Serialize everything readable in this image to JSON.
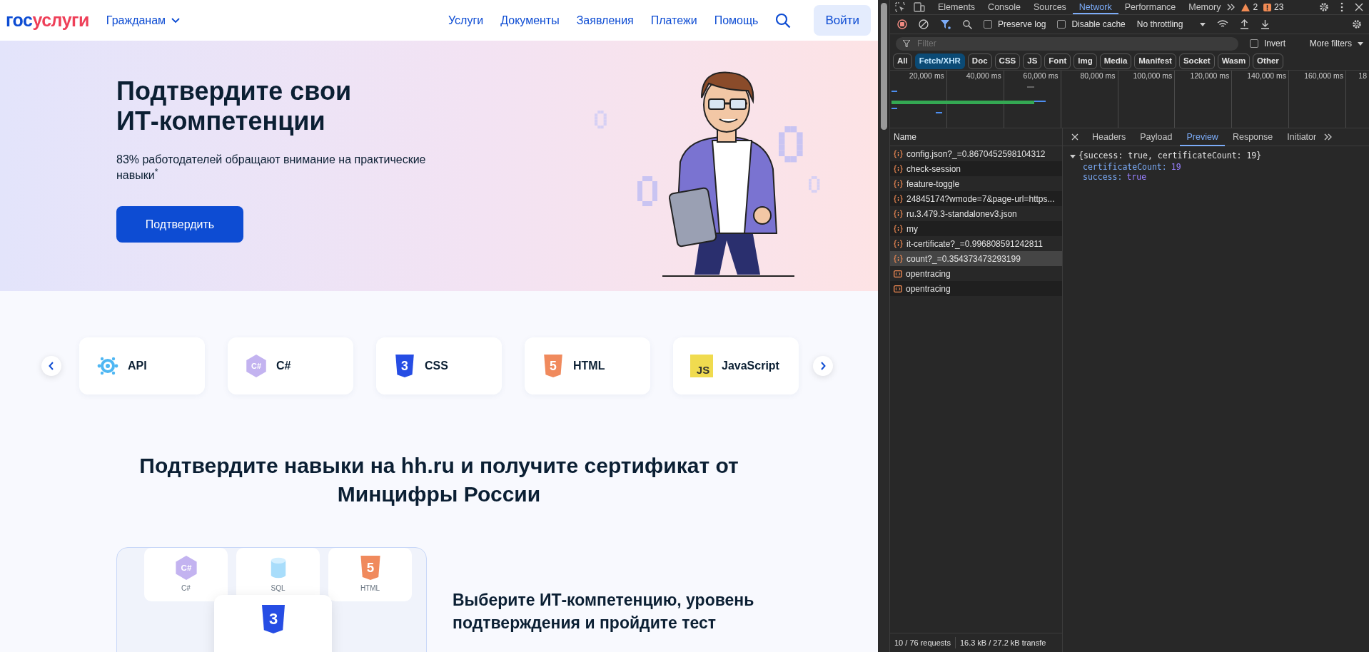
{
  "site": {
    "logo_first": "гос",
    "logo_second": "услуги",
    "audience": "Гражданам",
    "nav": [
      "Услуги",
      "Документы",
      "Заявления",
      "Платежи",
      "Помощь"
    ],
    "login": "Войти"
  },
  "hero": {
    "title": "Подтвердите свои ИТ-компетенции",
    "subtitle": "83% работодателей обращают внимание на практические навыки$^{*}$",
    "button": "Подтвердить"
  },
  "skills": [
    {
      "label": "API",
      "kind": "api"
    },
    {
      "label": "C#",
      "kind": "csharp",
      "badge": "C#"
    },
    {
      "label": "CSS",
      "kind": "css",
      "badge": "3"
    },
    {
      "label": "HTML",
      "kind": "html",
      "badge": "5"
    },
    {
      "label": "JavaScript",
      "kind": "js",
      "badge": "JS"
    }
  ],
  "section_title": "Подтвердите навыки на hh.ru и получите сертификат от Минцифры России",
  "preview_tiles": [
    {
      "label": "C#",
      "kind": "csharp",
      "badge": "C#"
    },
    {
      "label": "SQL",
      "kind": "sql"
    },
    {
      "label": "HTML",
      "kind": "html",
      "badge": "5"
    }
  ],
  "overlay_card": {
    "kind": "css",
    "badge": "3"
  },
  "step_text": "Выберите ИТ-компетенцию, уровень подтверждения и пройдите тест",
  "devtools": {
    "tabs": [
      {
        "label": "Elements",
        "selected": false
      },
      {
        "label": "Console",
        "selected": false
      },
      {
        "label": "Sources",
        "selected": false
      },
      {
        "label": "Network",
        "selected": true
      },
      {
        "label": "Performance",
        "selected": false
      },
      {
        "label": "Memory",
        "selected": false
      }
    ],
    "warnings": "2",
    "errors": "23",
    "recording": true,
    "preserve_log": {
      "label": "Preserve log",
      "checked": false
    },
    "disable_cache": {
      "label": "Disable cache",
      "checked": false
    },
    "throttling": "No throttling",
    "filter": {
      "placeholder": "Filter"
    },
    "invert": {
      "label": "Invert",
      "checked": false
    },
    "more_filters": "More filters",
    "types": [
      {
        "label": "All",
        "selected": false
      },
      {
        "label": "Fetch/XHR",
        "selected": true
      },
      {
        "label": "Doc",
        "selected": false
      },
      {
        "label": "CSS",
        "selected": false
      },
      {
        "label": "JS",
        "selected": false
      },
      {
        "label": "Font",
        "selected": false
      },
      {
        "label": "Img",
        "selected": false
      },
      {
        "label": "Media",
        "selected": false
      },
      {
        "label": "Manifest",
        "selected": false
      },
      {
        "label": "Socket",
        "selected": false
      },
      {
        "label": "Wasm",
        "selected": false
      },
      {
        "label": "Other",
        "selected": false
      }
    ],
    "timeline_ticks": [
      "20,000 ms",
      "40,000 ms",
      "60,000 ms",
      "80,000 ms",
      "100,000 ms",
      "120,000 ms",
      "140,000 ms",
      "160,000 ms",
      "18"
    ],
    "name_header": "Name",
    "requests": [
      {
        "name": "config.json?_=0.8670452598104312",
        "kind": "fetch",
        "selected": false
      },
      {
        "name": "check-session",
        "kind": "fetch",
        "selected": false
      },
      {
        "name": "feature-toggle",
        "kind": "fetch",
        "selected": false
      },
      {
        "name": "24845174?wmode=7&page-url=https...",
        "kind": "fetch",
        "selected": false
      },
      {
        "name": "ru.3.479.3-standalonev3.json",
        "kind": "fetch",
        "selected": false
      },
      {
        "name": "my",
        "kind": "fetch",
        "selected": false
      },
      {
        "name": "it-certificate?_=0.996808591242811",
        "kind": "fetch",
        "selected": false
      },
      {
        "name": "count?_=0.354373473293199",
        "kind": "fetch",
        "selected": true
      },
      {
        "name": "opentracing",
        "kind": "doc",
        "selected": false
      },
      {
        "name": "opentracing",
        "kind": "doc",
        "selected": false
      }
    ],
    "detail_tabs": [
      {
        "label": "Headers",
        "selected": false
      },
      {
        "label": "Payload",
        "selected": false
      },
      {
        "label": "Preview",
        "selected": true
      },
      {
        "label": "Response",
        "selected": false
      },
      {
        "label": "Initiator",
        "selected": false
      }
    ],
    "preview": {
      "summary": "{success: true, certificateCount: 19}",
      "expanded": true,
      "props": [
        {
          "key": "certificateCount:",
          "value": "19"
        },
        {
          "key": "success:",
          "value": "true"
        }
      ]
    },
    "status": [
      "10 / 76 requests",
      "16.3 kB / 27.2 kB transfe"
    ]
  }
}
